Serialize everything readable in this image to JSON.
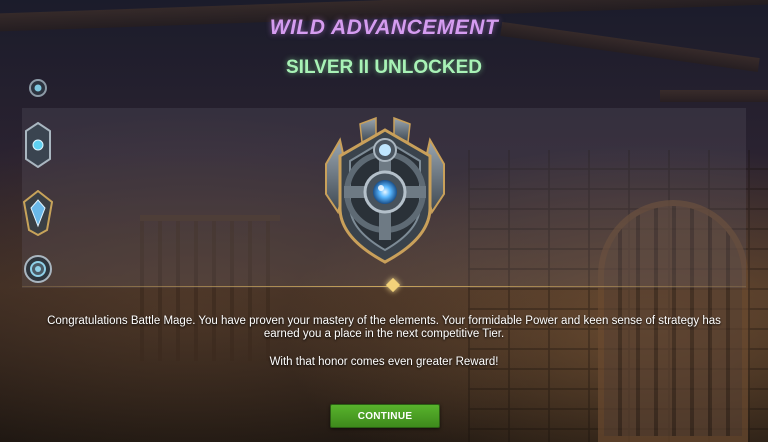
{
  "header": {
    "title": "WILD ADVANCEMENT",
    "subtitle": "SILVER II UNLOCKED"
  },
  "tier_rail": {
    "items": [
      {
        "name": "tier-small-round-icon",
        "color": "#7fc8e0"
      },
      {
        "name": "tier-shield-icon",
        "color": "#5fd0f0"
      },
      {
        "name": "tier-crystal-shield-icon",
        "color": "#6ab8e8"
      },
      {
        "name": "tier-round-emblem-icon",
        "color": "#8fd0e8"
      }
    ]
  },
  "badge": {
    "icon": "silver-tier-emblem-icon",
    "accent": "#5ab8ff"
  },
  "message": {
    "line1": "Congratulations Battle Mage. You have proven your mastery of the elements. Your formidable Power and keen sense of strategy has earned you a place in the next competitive Tier.",
    "line2": "With that honor comes even greater Reward!"
  },
  "actions": {
    "continue_label": "CONTINUE",
    "continue_color": "#4c9f22"
  }
}
